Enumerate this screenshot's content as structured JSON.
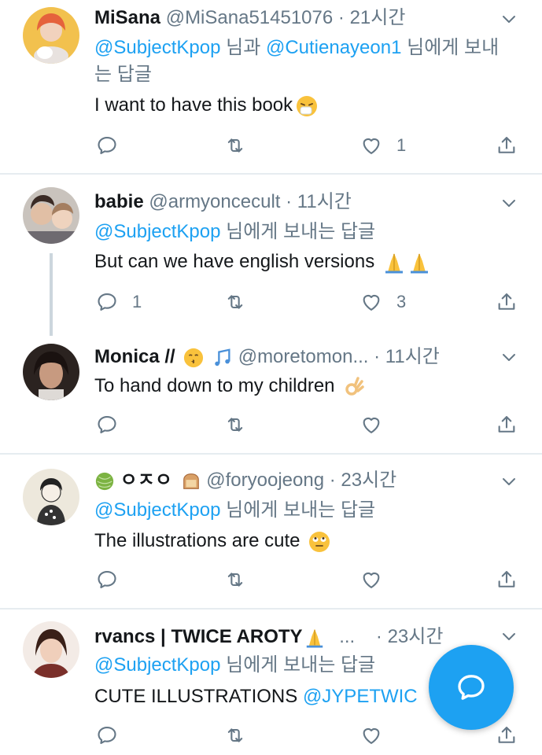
{
  "colors": {
    "accent": "#1da1f2",
    "secondary_text": "#657786",
    "divider": "#e6ecf0"
  },
  "tweets": [
    {
      "name": "MiSana",
      "handle": "@MiSana51451076",
      "dot": "·",
      "time": "21시간",
      "reply_prefix": "",
      "mention1": "@SubjectKpop",
      "mid": " 님과 ",
      "mention2": "@Cutienayeon1",
      "suffix": " 님에게 보내는 답글",
      "text": "I want to have this book",
      "reply_count": "",
      "retweet_count": "",
      "like_count": "1"
    },
    {
      "name": "babie",
      "handle": "@armyoncecult",
      "dot": "·",
      "time": "11시간",
      "mention1": "@SubjectKpop",
      "suffix": " 님에게 보내는 답글",
      "text": "But can we have english versions",
      "reply_count": "1",
      "retweet_count": "",
      "like_count": "3"
    },
    {
      "name": "Monica //",
      "handle": "@moretomon...",
      "dot": "·",
      "time": "11시간",
      "text": "To hand down to my children",
      "reply_count": "",
      "retweet_count": "",
      "like_count": ""
    },
    {
      "name": "ㅇㅈㅇ",
      "handle": "@foryoojeong",
      "dot": "·",
      "time": "23시간",
      "mention1": "@SubjectKpop",
      "suffix": " 님에게 보내는 답글",
      "text": "The illustrations are cute",
      "reply_count": "",
      "retweet_count": "",
      "like_count": ""
    },
    {
      "name": "rvancs | TWICE AROTY",
      "handle": "...",
      "dot": "·",
      "time": "23시간",
      "mention1": "@SubjectKpop",
      "suffix": " 님에게 보내는 답글",
      "text": "CUTE ILLUSTRATIONS ",
      "text_mention": "@JYPETWIC",
      "reply_count": "",
      "retweet_count": "",
      "like_count": ""
    }
  ],
  "icons": {
    "reply": "reply-icon",
    "retweet": "retweet-icon",
    "like": "heart-icon",
    "share": "share-icon",
    "more": "chevron-down-icon",
    "compose": "compose-reply-icon"
  }
}
